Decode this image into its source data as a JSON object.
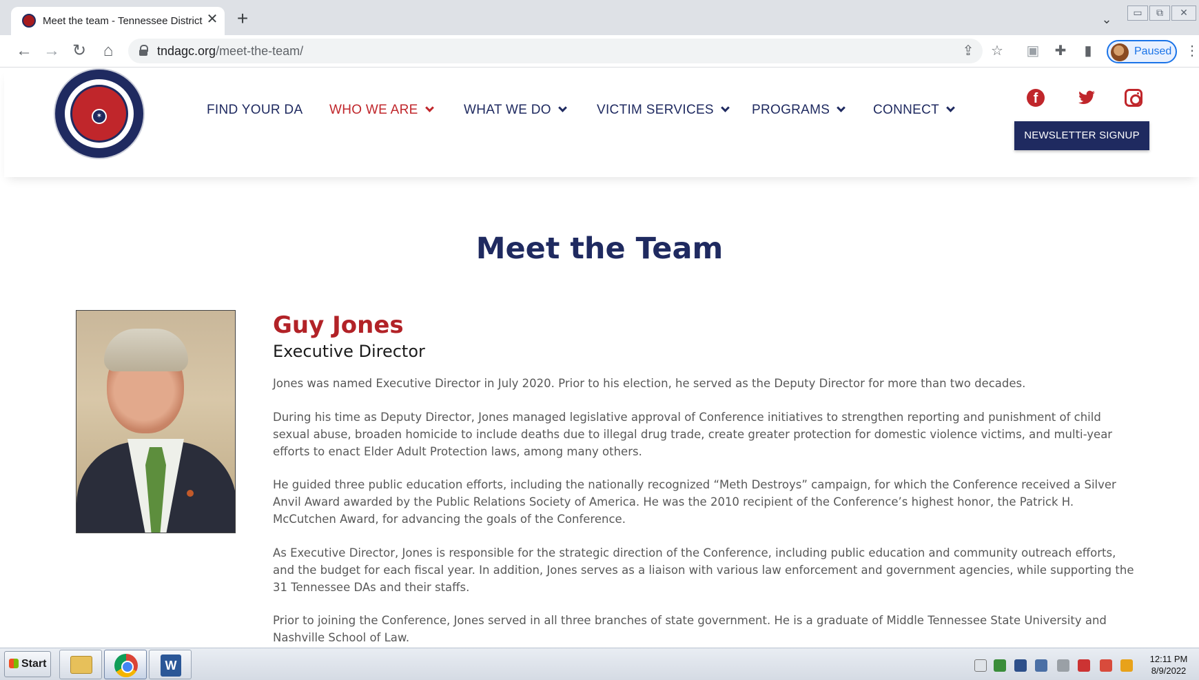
{
  "browser": {
    "tab": {
      "title": "Meet the team - Tennessee District",
      "close_glyph": "✕"
    },
    "new_tab_glyph": "+",
    "url_host": "tndagc.org",
    "url_path": "/meet-the-team/",
    "profile_label": "Paused"
  },
  "site": {
    "nav": [
      {
        "label": "FIND YOUR DA",
        "active": false,
        "dropdown": false
      },
      {
        "label": "WHO WE ARE",
        "active": true,
        "dropdown": true
      },
      {
        "label": "WHAT WE DO",
        "active": false,
        "dropdown": true
      },
      {
        "label": "VICTIM SERVICES",
        "active": false,
        "dropdown": true
      },
      {
        "label": "PROGRAMS",
        "active": false,
        "dropdown": true
      },
      {
        "label": "CONNECT",
        "active": false,
        "dropdown": true
      }
    ],
    "newsletter_label": "NEWSLETTER SIGNUP",
    "colors": {
      "navy": "#1f2a60",
      "red": "#c0262b"
    }
  },
  "main": {
    "title": "Meet the Team",
    "member": {
      "name": "Guy Jones",
      "role": "Executive Director",
      "bio": [
        "Jones was named Executive Director in July 2020. Prior to his election, he served as the Deputy Director for more than two decades.",
        "During his time as Deputy Director, Jones managed legislative approval of Conference initiatives to strengthen reporting and punishment of child sexual abuse, broaden homicide to include deaths due to illegal drug trade, create greater protection for domestic violence victims, and multi-year efforts to enact Elder Adult Protection laws, among many others.",
        "He guided three public education efforts, including the nationally recognized “Meth Destroys” campaign, for which the Conference received a Silver Anvil Award awarded by the Public Relations Society of America. He was the 2010 recipient of the Conference’s highest honor, the Patrick H. McCutchen Award, for advancing the goals of the Conference.",
        "As Executive Director, Jones is responsible for the strategic direction of the Conference, including public education and community outreach efforts, and the budget for each fiscal year. In addition, Jones serves as a liaison with various law enforcement and government agencies, while supporting the 31 Tennessee DAs and their staffs.",
        "Prior to joining the Conference, Jones served in all three branches of state government. He is a graduate of Middle Tennessee State University and Nashville School of Law."
      ]
    }
  },
  "taskbar": {
    "start_label": "Start",
    "time": "12:11 PM",
    "date": "8/9/2022"
  }
}
